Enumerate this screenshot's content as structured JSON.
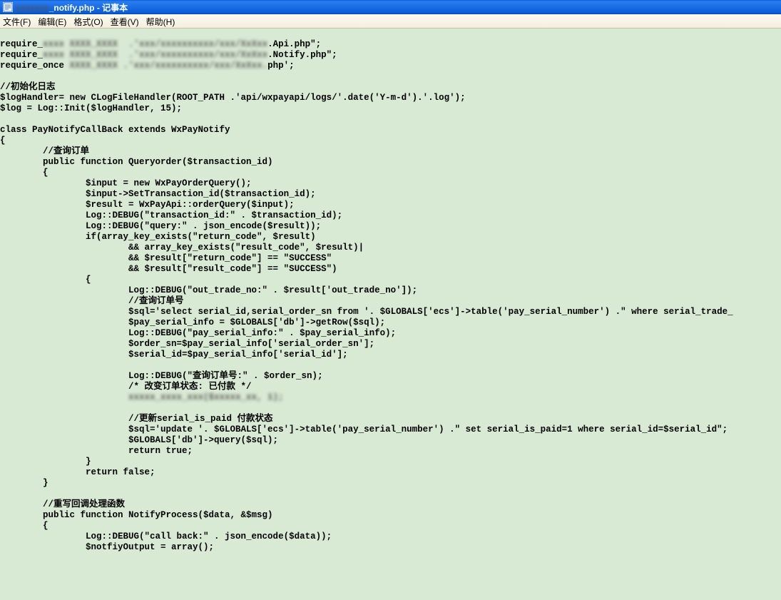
{
  "titlebar": {
    "filename_blur": "xxxxxxx",
    "filename_clear": "_notify.php",
    "separator": " - ",
    "app": "记事本"
  },
  "menubar": {
    "file": "文件(F)",
    "edit": "编辑(E)",
    "format": "格式(O)",
    "view": "查看(V)",
    "help": "帮助(H)"
  },
  "code": {
    "l01a": "require_",
    "l01b": "xxxx XXXX_XXXX  .'xxx/xxxxxxxxxx/xxx/XxXxx",
    "l01c": ".Api.php\";",
    "l02a": "require_",
    "l02b": "xxxx XXXX_XXXX  .'xxx/xxxxxxxxxx/xxx/XxXxx",
    "l02c": ".Notify.php\";",
    "l03a": "require_once ",
    "l03b": "XXXX_XXXX .'xxx/xxxxxxxxxx/xxx/XxXxx.",
    "l03c": "php';",
    "l04": "",
    "l05": "//初始化日志",
    "l06": "$logHandler= new CLogFileHandler(ROOT_PATH .'api/wxpayapi/logs/'.date('Y-m-d').'.log');",
    "l07": "$log = Log::Init($logHandler, 15);",
    "l08": "",
    "l09": "class PayNotifyCallBack extends WxPayNotify",
    "l10": "{",
    "l11": "        //查询订单",
    "l12": "        public function Queryorder($transaction_id)",
    "l13": "        {",
    "l14": "                $input = new WxPayOrderQuery();",
    "l15": "                $input->SetTransaction_id($transaction_id);",
    "l16": "                $result = WxPayApi::orderQuery($input);",
    "l17": "                Log::DEBUG(\"transaction_id:\" . $transaction_id);",
    "l18": "                Log::DEBUG(\"query:\" . json_encode($result));",
    "l19": "                if(array_key_exists(\"return_code\", $result)",
    "l20": "                        && array_key_exists(\"result_code\", $result)|",
    "l21": "                        && $result[\"return_code\"] == \"SUCCESS\"",
    "l22": "                        && $result[\"result_code\"] == \"SUCCESS\")",
    "l23": "                {",
    "l24": "                        Log::DEBUG(\"out_trade_no:\" . $result['out_trade_no']);",
    "l25": "                        //查询订单号",
    "l26": "                        $sql='select serial_id,serial_order_sn from '. $GLOBALS['ecs']->table('pay_serial_number') .\" where serial_trade_",
    "l27": "                        $pay_serial_info = $GLOBALS['db']->getRow($sql);",
    "l28": "                        Log::DEBUG(\"pay_serial_info:\" . $pay_serial_info);",
    "l29": "                        $order_sn=$pay_serial_info['serial_order_sn'];",
    "l30": "                        $serial_id=$pay_serial_info['serial_id'];",
    "l31": "",
    "l32": "                        Log::DEBUG(\"查询订单号:\" . $order_sn);",
    "l33": "                        /* 改变订单状态: 已付款 */",
    "l34b": "                        xxxxx_xxxx_xxx($xxxxx_xx, 1);",
    "l35": "",
    "l36": "                        //更新serial_is_paid 付款状态",
    "l37": "                        $sql='update '. $GLOBALS['ecs']->table('pay_serial_number') .\" set serial_is_paid=1 where serial_id=$serial_id\";",
    "l38": "                        $GLOBALS['db']->query($sql);",
    "l39": "                        return true;",
    "l40": "                }",
    "l41": "                return false;",
    "l42": "        }",
    "l43": "",
    "l44": "        //重写回调处理函数",
    "l45": "        public function NotifyProcess($data, &$msg)",
    "l46": "        {",
    "l47": "                Log::DEBUG(\"call back:\" . json_encode($data));",
    "l48": "                $notfiyOutput = array();"
  }
}
